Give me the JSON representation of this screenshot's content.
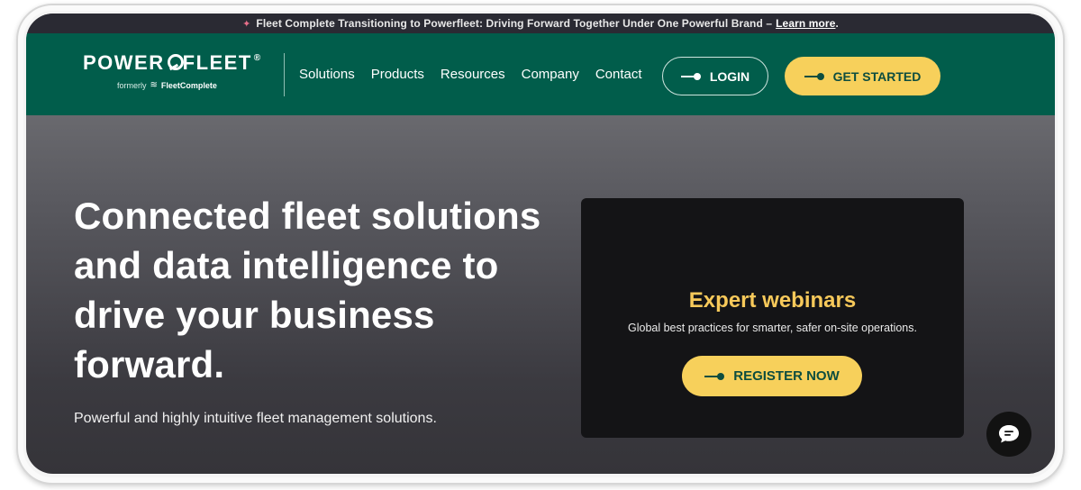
{
  "announcement": {
    "text": "Fleet Complete Transitioning to Powerfleet: Driving Forward Together Under One Powerful Brand –",
    "link": "Learn more",
    "suffix": "."
  },
  "logo": {
    "left": "POWER",
    "right": "FLEET",
    "registered": "®",
    "formerly": "formerly",
    "former_brand": "FleetComplete"
  },
  "nav": {
    "items": [
      "Solutions",
      "Products",
      "Resources",
      "Company",
      "Contact"
    ],
    "login_label": "LOGIN",
    "get_started_label": "GET STARTED"
  },
  "hero": {
    "title": "Connected fleet solutions and data intelligence to drive your business forward.",
    "subtitle": "Powerful and highly intuitive fleet management solutions."
  },
  "promo_card": {
    "title": "Expert webinars",
    "subtitle": "Global best practices for smarter, safer on-site operations.",
    "cta_label": "REGISTER NOW"
  },
  "colors": {
    "nav_bg": "#015d4b",
    "accent_yellow": "#f7d05b",
    "card_title": "#f7c95a",
    "announce_bg": "#2a2a33"
  },
  "icons": {
    "announce": "sparkle-icon",
    "button_arrow": "arrow-dot-icon",
    "chat": "chat-bubble-icon"
  }
}
